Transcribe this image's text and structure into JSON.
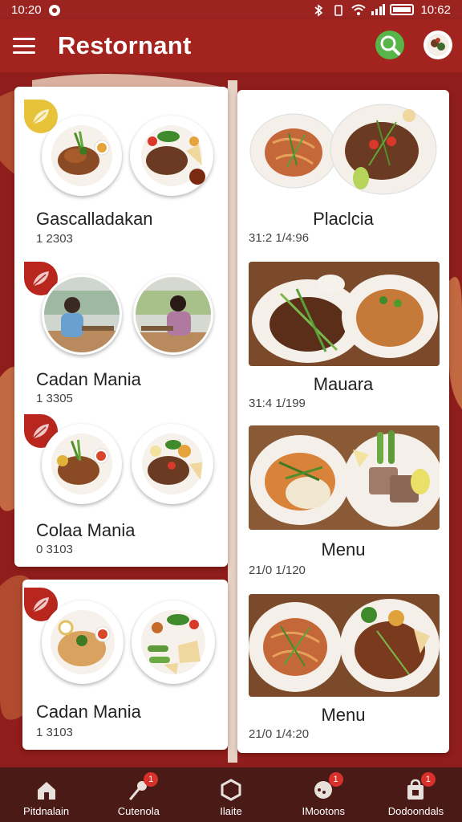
{
  "status_bar": {
    "time": "10:20",
    "time_right": "10:62"
  },
  "app_bar": {
    "title": "Restornant"
  },
  "left_column": [
    {
      "name": "Gascalladakan",
      "meta": "1 2303"
    },
    {
      "name": "Cadan Mania",
      "meta": "1 3305"
    },
    {
      "name": "Colaa Mania",
      "meta": "0 3103"
    },
    {
      "name": "Cadan Mania",
      "meta": "1 3103"
    }
  ],
  "right_column": [
    {
      "name": "Placlcia",
      "meta": "31:2 1/4:96"
    },
    {
      "name": "Mauara",
      "meta": "31:4 1/199"
    },
    {
      "name": "Menu",
      "meta": "21/0 1/120"
    },
    {
      "name": "Menu",
      "meta": "21/0 1/4:20"
    }
  ],
  "bottom_nav": [
    {
      "label": "Pitdnalain",
      "badge": ""
    },
    {
      "label": "Cutenola",
      "badge": "1"
    },
    {
      "label": "Ilaite",
      "badge": ""
    },
    {
      "label": "IMootons",
      "badge": "1"
    },
    {
      "label": "Dodoondals",
      "badge": "1"
    }
  ],
  "colors": {
    "primary": "#a3231f",
    "nav": "#4a1a16",
    "accent_green": "#57b54a",
    "badge_red": "#d8302a",
    "leaf_yellow": "#e7c33a"
  }
}
